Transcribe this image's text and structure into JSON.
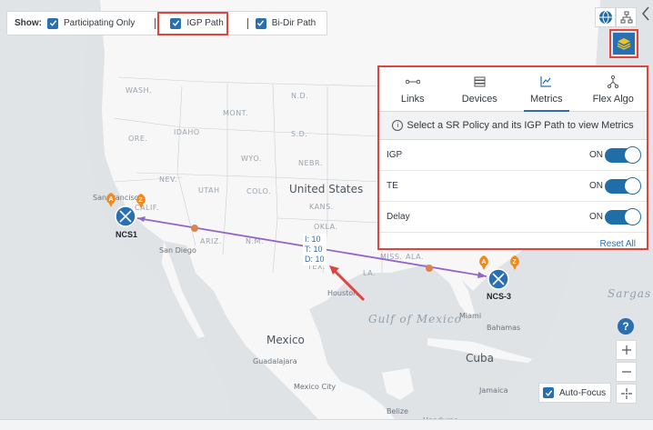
{
  "show_bar": {
    "label": "Show:",
    "options": [
      {
        "label": "Participating Only",
        "checked": true
      },
      {
        "label": "IGP Path",
        "checked": true
      },
      {
        "label": "Bi-Dir Path",
        "checked": true
      }
    ]
  },
  "panel": {
    "tabs": [
      {
        "label": "Links",
        "icon": "links-icon",
        "active": false
      },
      {
        "label": "Devices",
        "icon": "devices-icon",
        "active": false
      },
      {
        "label": "Metrics",
        "icon": "metrics-icon",
        "active": true
      },
      {
        "label": "Flex Algo",
        "icon": "flex-algo-icon",
        "active": false
      }
    ],
    "info_text": "Select a SR Policy and its IGP Path to view Metrics",
    "metrics": [
      {
        "label": "IGP",
        "state": "ON"
      },
      {
        "label": "TE",
        "state": "ON"
      },
      {
        "label": "Delay",
        "state": "ON"
      }
    ],
    "reset_label": "Reset All"
  },
  "nodes": {
    "ncs1": "NCS1",
    "ncs3": "NCS-3",
    "marker_a": "A",
    "marker_z": "Z"
  },
  "path_metrics": {
    "igp": "I: 10",
    "te": "T: 10",
    "delay": "D: 10"
  },
  "map_labels": {
    "country_us": "United States",
    "country_mx": "Mexico",
    "country_cuba": "Cuba",
    "gulf": "Gulf of Mexico",
    "sargasso": "Sargas Se",
    "states": [
      "WASH.",
      "ORE.",
      "IDAHO",
      "MONT.",
      "WYO.",
      "NEV.",
      "UTAH",
      "COLO.",
      "ARIZ.",
      "N.M.",
      "N.D.",
      "S.D.",
      "NEBR.",
      "KANS.",
      "OKLA.",
      "TEX.",
      "LA.",
      "MISS.",
      "ALA.",
      "CALIF."
    ],
    "cities": [
      "San Francisco",
      "San Diego",
      "Houston",
      "Miami",
      "Bahamas",
      "Guadalajara",
      "Mexico City",
      "Jamaica",
      "Belize",
      "Honduras"
    ]
  },
  "auto_focus": {
    "label": "Auto-Focus",
    "checked": true
  },
  "colors": {
    "highlight": "#e0443f",
    "accent": "#2a6fb0",
    "path": "#9366c9",
    "marker": "#f08a1f"
  }
}
